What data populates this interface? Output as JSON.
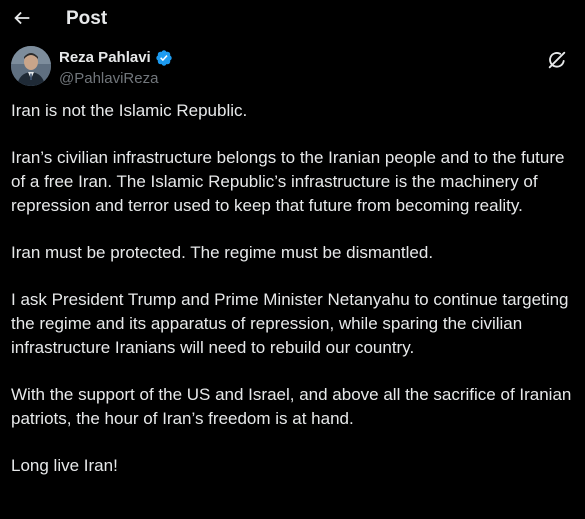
{
  "header": {
    "title": "Post",
    "back_icon": "arrow-left-icon"
  },
  "author": {
    "display_name": "Reza Pahlavi",
    "handle": "@PahlaviReza",
    "verified": true,
    "verified_color": "#1d9bf0",
    "avatar_icon": "profile-photo"
  },
  "actions": {
    "grok_icon": "grok-icon"
  },
  "post": {
    "paragraphs": [
      "Iran is not the Islamic Republic.",
      "Iran’s civilian infrastructure belongs to the Iranian people and to the future of a free Iran. The Islamic Republic’s infrastructure is the machinery of repression and terror used to keep that future from becoming reality.",
      "Iran must be protected. The regime must be dismantled.",
      "I ask President Trump and Prime Minister Netanyahu to continue targeting the regime and its apparatus of repression, while sparing the civilian infrastructure Iranians will need to rebuild our country.",
      "With the support of the US and Israel, and above all the sacrifice of Iranian patriots, the hour of Iran’s freedom is at hand.",
      "Long live Iran!"
    ]
  },
  "colors": {
    "background": "#000000",
    "text_primary": "#e7e9ea",
    "text_secondary": "#71767b"
  }
}
